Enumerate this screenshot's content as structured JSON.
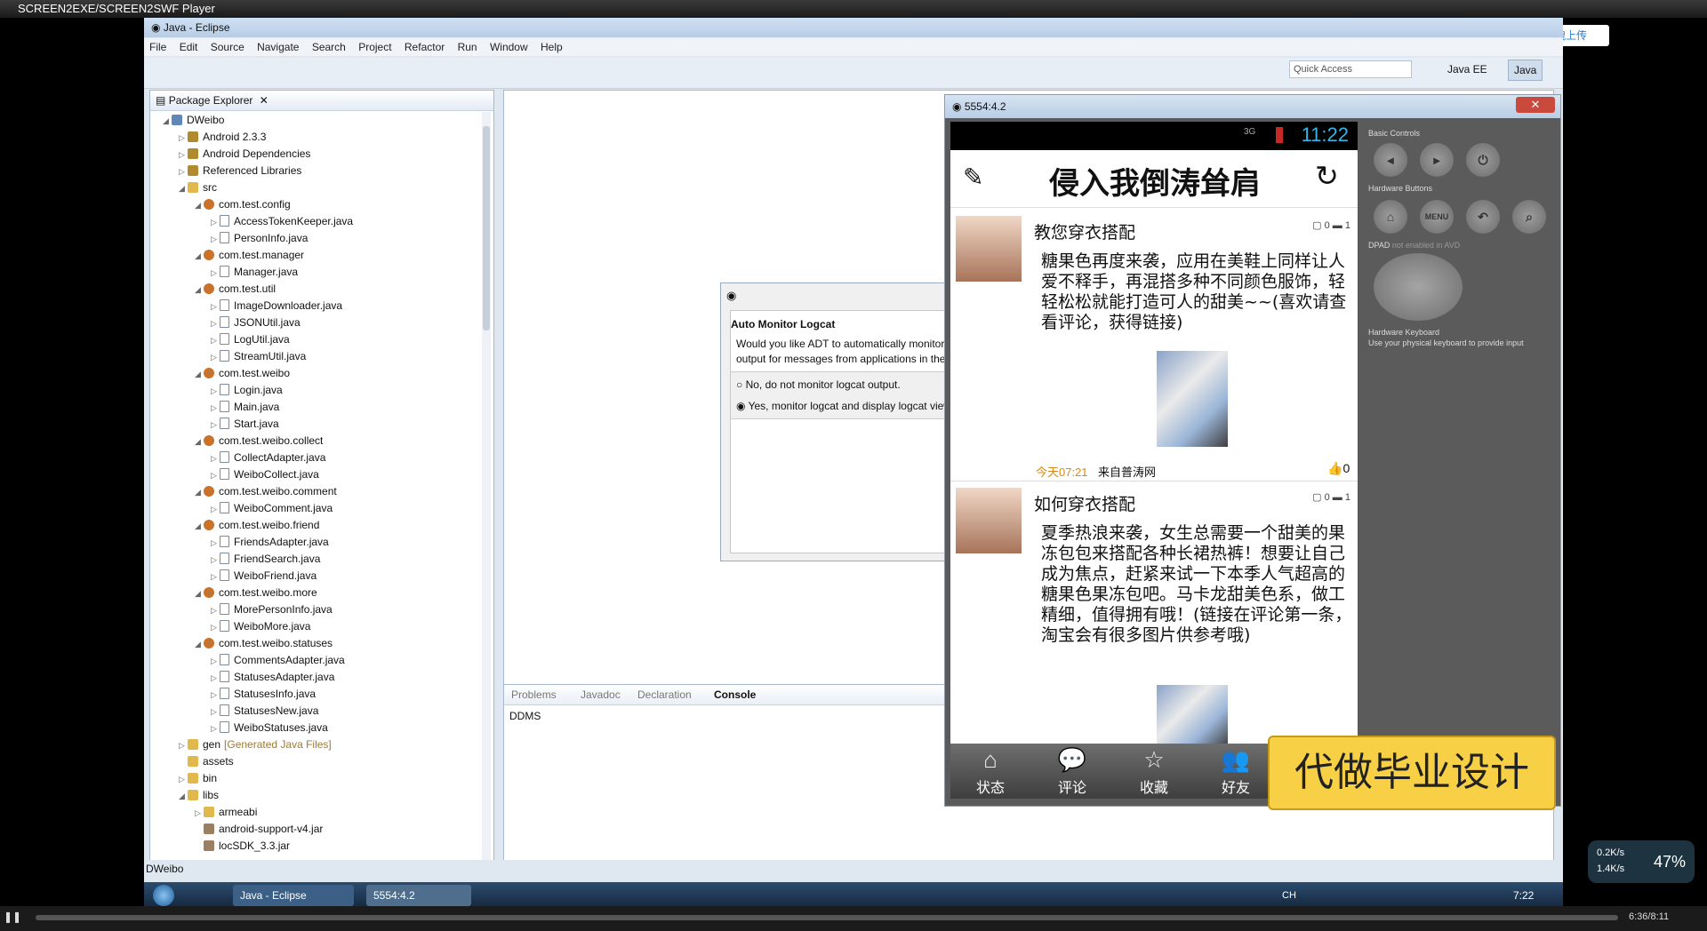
{
  "player": {
    "title": "SCREEN2EXE/SCREEN2SWF Player",
    "time": "6:36/8:11"
  },
  "upload": {
    "label": "拖拽上传"
  },
  "eclipse": {
    "title": "Java - Eclipse",
    "menu": [
      "File",
      "Edit",
      "Source",
      "Navigate",
      "Search",
      "Project",
      "Refactor",
      "Run",
      "Window",
      "Help"
    ],
    "quick_access": "Quick Access",
    "perspectives": [
      "Java EE",
      "Java"
    ],
    "status_text": "DWeibo"
  },
  "package_explorer": {
    "title": "Package Explorer",
    "rows": [
      {
        "label": "DWeibo",
        "indent": 0,
        "tw": "◢",
        "icon": "proj"
      },
      {
        "label": "Android 2.3.3",
        "indent": 1,
        "tw": "▷",
        "icon": "lib"
      },
      {
        "label": "Android Dependencies",
        "indent": 1,
        "tw": "▷",
        "icon": "lib"
      },
      {
        "label": "Referenced Libraries",
        "indent": 1,
        "tw": "▷",
        "icon": "lib"
      },
      {
        "label": "src",
        "indent": 1,
        "tw": "◢",
        "icon": "fold"
      },
      {
        "label": "com.test.config",
        "indent": 2,
        "tw": "◢",
        "icon": "pkg"
      },
      {
        "label": "AccessTokenKeeper.java",
        "indent": 3,
        "tw": "▷",
        "icon": "java"
      },
      {
        "label": "PersonInfo.java",
        "indent": 3,
        "tw": "▷",
        "icon": "java"
      },
      {
        "label": "com.test.manager",
        "indent": 2,
        "tw": "◢",
        "icon": "pkg"
      },
      {
        "label": "Manager.java",
        "indent": 3,
        "tw": "▷",
        "icon": "java"
      },
      {
        "label": "com.test.util",
        "indent": 2,
        "tw": "◢",
        "icon": "pkg"
      },
      {
        "label": "ImageDownloader.java",
        "indent": 3,
        "tw": "▷",
        "icon": "java"
      },
      {
        "label": "JSONUtil.java",
        "indent": 3,
        "tw": "▷",
        "icon": "java"
      },
      {
        "label": "LogUtil.java",
        "indent": 3,
        "tw": "▷",
        "icon": "java"
      },
      {
        "label": "StreamUtil.java",
        "indent": 3,
        "tw": "▷",
        "icon": "java"
      },
      {
        "label": "com.test.weibo",
        "indent": 2,
        "tw": "◢",
        "icon": "pkg"
      },
      {
        "label": "Login.java",
        "indent": 3,
        "tw": "▷",
        "icon": "java"
      },
      {
        "label": "Main.java",
        "indent": 3,
        "tw": "▷",
        "icon": "java"
      },
      {
        "label": "Start.java",
        "indent": 3,
        "tw": "▷",
        "icon": "java"
      },
      {
        "label": "com.test.weibo.collect",
        "indent": 2,
        "tw": "◢",
        "icon": "pkg"
      },
      {
        "label": "CollectAdapter.java",
        "indent": 3,
        "tw": "▷",
        "icon": "java"
      },
      {
        "label": "WeiboCollect.java",
        "indent": 3,
        "tw": "▷",
        "icon": "java"
      },
      {
        "label": "com.test.weibo.comment",
        "indent": 2,
        "tw": "◢",
        "icon": "pkg"
      },
      {
        "label": "WeiboComment.java",
        "indent": 3,
        "tw": "▷",
        "icon": "java"
      },
      {
        "label": "com.test.weibo.friend",
        "indent": 2,
        "tw": "◢",
        "icon": "pkg"
      },
      {
        "label": "FriendsAdapter.java",
        "indent": 3,
        "tw": "▷",
        "icon": "java"
      },
      {
        "label": "FriendSearch.java",
        "indent": 3,
        "tw": "▷",
        "icon": "java"
      },
      {
        "label": "WeiboFriend.java",
        "indent": 3,
        "tw": "▷",
        "icon": "java"
      },
      {
        "label": "com.test.weibo.more",
        "indent": 2,
        "tw": "◢",
        "icon": "pkg"
      },
      {
        "label": "MorePersonInfo.java",
        "indent": 3,
        "tw": "▷",
        "icon": "java"
      },
      {
        "label": "WeiboMore.java",
        "indent": 3,
        "tw": "▷",
        "icon": "java"
      },
      {
        "label": "com.test.weibo.statuses",
        "indent": 2,
        "tw": "◢",
        "icon": "pkg"
      },
      {
        "label": "CommentsAdapter.java",
        "indent": 3,
        "tw": "▷",
        "icon": "java"
      },
      {
        "label": "StatusesAdapter.java",
        "indent": 3,
        "tw": "▷",
        "icon": "java"
      },
      {
        "label": "StatusesInfo.java",
        "indent": 3,
        "tw": "▷",
        "icon": "java"
      },
      {
        "label": "StatusesNew.java",
        "indent": 3,
        "tw": "▷",
        "icon": "java"
      },
      {
        "label": "WeiboStatuses.java",
        "indent": 3,
        "tw": "▷",
        "icon": "java"
      },
      {
        "label": "gen",
        "suffix": "[Generated Java Files]",
        "indent": 1,
        "tw": "▷",
        "icon": "fold"
      },
      {
        "label": "assets",
        "indent": 1,
        "tw": "",
        "icon": "fold"
      },
      {
        "label": "bin",
        "indent": 1,
        "tw": "▷",
        "icon": "fold"
      },
      {
        "label": "libs",
        "indent": 1,
        "tw": "◢",
        "icon": "fold"
      },
      {
        "label": "armeabi",
        "indent": 2,
        "tw": "▷",
        "icon": "fold"
      },
      {
        "label": "android-support-v4.jar",
        "indent": 2,
        "tw": "",
        "icon": "jar"
      },
      {
        "label": "locSDK_3.3.jar",
        "indent": 2,
        "tw": "",
        "icon": "jar"
      }
    ]
  },
  "dialog": {
    "title": "Auto Monitor Logcat",
    "message_line1": "Would you like ADT to automatically monitor logcat",
    "message_line2": "output for messages from applications in the workspace?",
    "option_no": "No, do not monitor logcat output.",
    "option_yes": "Yes, monitor logcat and display logcat view if there aremessages with"
  },
  "console": {
    "tabs": [
      "Problems",
      "Javadoc",
      "Declaration",
      "Console"
    ],
    "active_tab": "Console",
    "body": "DDMS"
  },
  "taskbar": {
    "items": [
      "Java - Eclipse",
      "5554:4.2"
    ],
    "clock": "7:22",
    "lang": "CH"
  },
  "emulator": {
    "title": "5554:4.2",
    "clock": "11:22",
    "network": "3G",
    "app_title": "侵入我倒涛耸肩",
    "controls": {
      "basic": "Basic Controls",
      "hardware": "Hardware Buttons",
      "menu": "MENU",
      "dpad_note_a": "DPAD",
      "dpad_note_b": "not enabled in AVD",
      "keyboard": "Hardware Keyboard",
      "keyboard_hint": "Use your physical keyboard to provide input"
    },
    "posts": [
      {
        "title": "教您穿衣搭配",
        "body": "糖果色再度来袭，应用在美鞋上同样让人爱不释手，再混搭多种不同颜色服饰，轻轻松松就能打造可人的甜美~~(喜欢请查看评论，获得链接)",
        "time": "今天07:21",
        "source": "来自普涛网",
        "reposts": "0",
        "comments": "1",
        "likes": "0"
      },
      {
        "title": "如何穿衣搭配",
        "body": "夏季热浪来袭，女生总需要一个甜美的果冻包包来搭配各种长裙热裤！想要让自己成为焦点，赶紧来试一下本季人气超高的糖果色果冻包吧。马卡龙甜美色系，做工精细，值得拥有哦！(链接在评论第一条，淘宝会有很多图片供参考哦)",
        "reposts": "0",
        "comments": "1"
      }
    ],
    "tabs": [
      "状态",
      "评论",
      "收藏",
      "好友"
    ]
  },
  "banner": {
    "text": "代做毕业设计"
  },
  "net_monitor": {
    "up": "0.2K/s",
    "down": "1.4K/s",
    "percent": "47%"
  }
}
